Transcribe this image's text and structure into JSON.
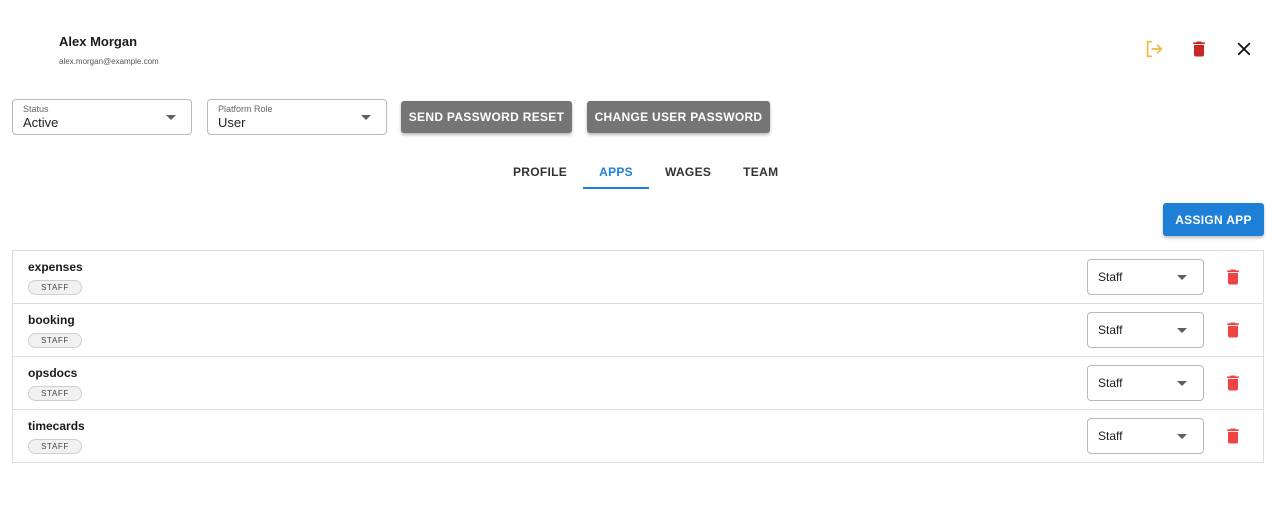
{
  "user": {
    "name": "Alex Morgan",
    "email": "alex.morgan@example.com"
  },
  "header_icons": [
    {
      "name": "logout-icon",
      "color": "#f2b63a"
    },
    {
      "name": "delete-icon",
      "color": "#c62828"
    },
    {
      "name": "close-icon",
      "color": "#212121"
    }
  ],
  "status_select": {
    "label": "Status",
    "value": "Active"
  },
  "role_select": {
    "label": "Platform Role",
    "value": "User"
  },
  "actions": {
    "reset_label": "SEND PASSWORD RESET",
    "change_label": "CHANGE USER PASSWORD"
  },
  "tabs": [
    {
      "label": "PROFILE",
      "active": false
    },
    {
      "label": "APPS",
      "active": true
    },
    {
      "label": "WAGES",
      "active": false
    },
    {
      "label": "TEAM",
      "active": false
    }
  ],
  "assign_label": "ASSIGN APP",
  "apps": [
    {
      "name": "expenses",
      "badge": "STAFF",
      "role": "Staff"
    },
    {
      "name": "booking",
      "badge": "STAFF",
      "role": "Staff"
    },
    {
      "name": "opsdocs",
      "badge": "STAFF",
      "role": "Staff"
    },
    {
      "name": "timecards",
      "badge": "STAFF",
      "role": "Staff"
    }
  ],
  "colors": {
    "accent": "#1e7fd6",
    "gray_button": "#757575",
    "row_delete": "#ef4444",
    "logout": "#f2b63a",
    "delete": "#c62828"
  }
}
